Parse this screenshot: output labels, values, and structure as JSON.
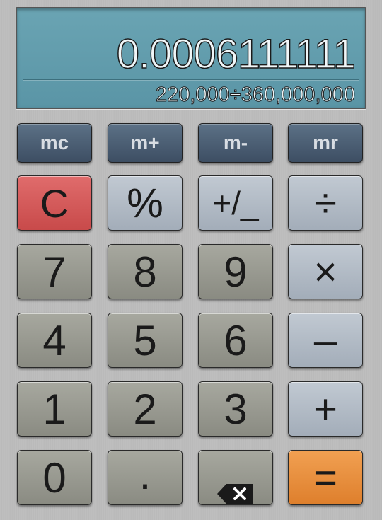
{
  "display": {
    "result": "0.0006111111",
    "expression": "220,000÷360,000,000"
  },
  "memory_keys": [
    "mc",
    "m+",
    "m-",
    "mr"
  ],
  "keys": {
    "clear": "C",
    "percent": "%",
    "plus_minus": "+/_",
    "divide": "÷",
    "multiply": "×",
    "minus": "–",
    "plus": "+",
    "equals": "=",
    "decimal": ".",
    "digits": [
      "0",
      "1",
      "2",
      "3",
      "4",
      "5",
      "6",
      "7",
      "8",
      "9"
    ]
  },
  "icons": {
    "backspace": "backspace-icon"
  },
  "colors": {
    "display_bg": "#5f9aab",
    "clear_key": "#d45a5a",
    "equals_key": "#e88d3c",
    "memory_key": "#4a5c70"
  }
}
